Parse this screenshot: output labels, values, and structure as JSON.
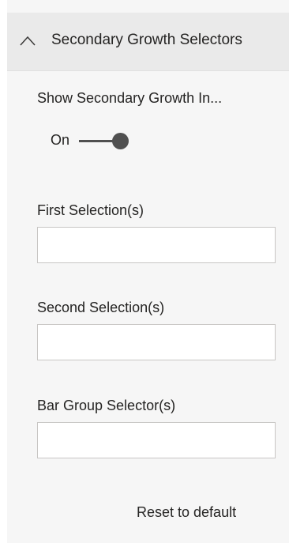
{
  "header": {
    "title": "Secondary Growth Selectors",
    "chevron_icon": "chevron-up-icon"
  },
  "show_secondary": {
    "label": "Show Secondary Growth In...",
    "toggle_state_label": "On",
    "toggle_on": true,
    "toggle_color": "#505050"
  },
  "first_selection": {
    "label": "First Selection(s)",
    "value": ""
  },
  "second_selection": {
    "label": "Second Selection(s)",
    "value": ""
  },
  "bar_group_selector": {
    "label": "Bar Group Selector(s)",
    "value": ""
  },
  "footer": {
    "reset_label": "Reset to default"
  },
  "colors": {
    "panel_background": "#f6f6f6",
    "header_background": "#eaeaea",
    "text": "#252423",
    "input_border": "#c8c6c4"
  }
}
